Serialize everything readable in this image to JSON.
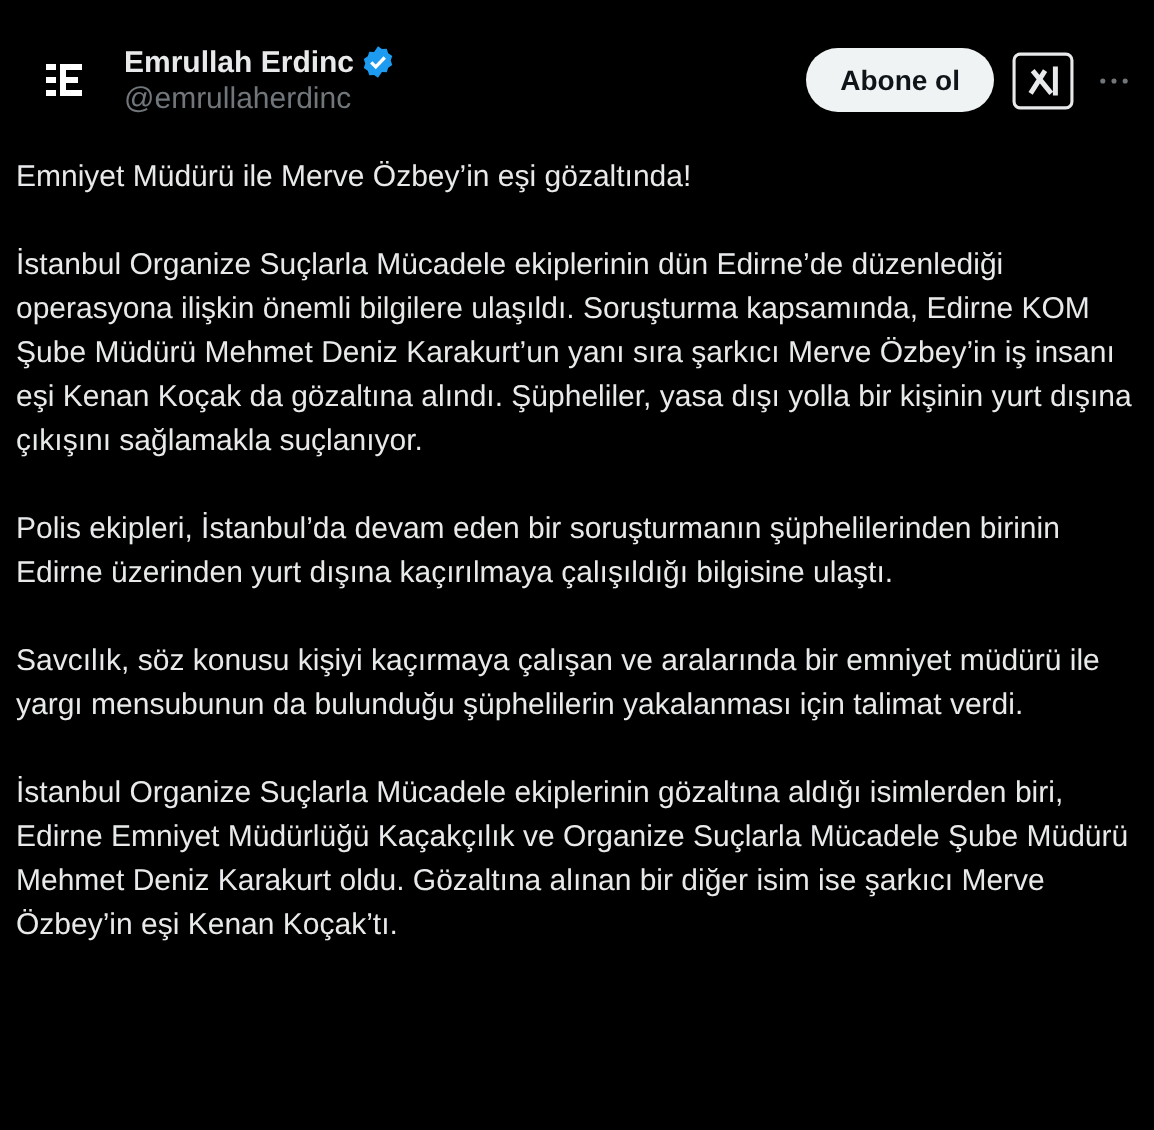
{
  "author": {
    "name": "Emrullah Erdinc",
    "verified": true,
    "handle": "@emrullaherdinc"
  },
  "follow_button": {
    "label": "Abone ol"
  },
  "paragraphs": [
    "Emniyet Müdürü ile Merve Özbey’in eşi gözaltında!",
    "İstanbul Organize Suçlarla Mücadele ekiplerinin dün Edirne’de düzenlediği operasyona ilişkin önemli bilgilere ulaşıldı. Soruşturma kapsamında, Edirne KOM Şube Müdürü Mehmet Deniz Karakurt’un yanı sıra şarkıcı Merve Özbey’in iş insanı eşi Kenan Koçak da gözaltına alındı. Şüpheliler, yasa dışı yolla bir kişinin yurt dışına çıkışını sağlamakla suçlanıyor.",
    "Polis ekipleri, İstanbul’da devam eden bir soruşturmanın şüphelilerinden birinin Edirne üzerinden yurt dışına kaçırılmaya çalışıldığı bilgisine ulaştı.",
    "Savcılık, söz konusu kişiyi kaçırmaya çalışan ve aralarında bir emniyet müdürü ile yargı mensubunun da bulunduğu şüphelilerin yakalanması için talimat verdi.",
    "İstanbul Organize Suçlarla Mücadele ekiplerinin gözaltına aldığı isimlerden biri, Edirne Emniyet Müdürlüğü Kaçakçılık ve Organize Suçlarla Mücadele Şube Müdürü Mehmet Deniz Karakurt oldu. Gözaltına alınan bir diğer isim ise şarkıcı Merve Özbey’in eşi Kenan Koçak’tı."
  ]
}
